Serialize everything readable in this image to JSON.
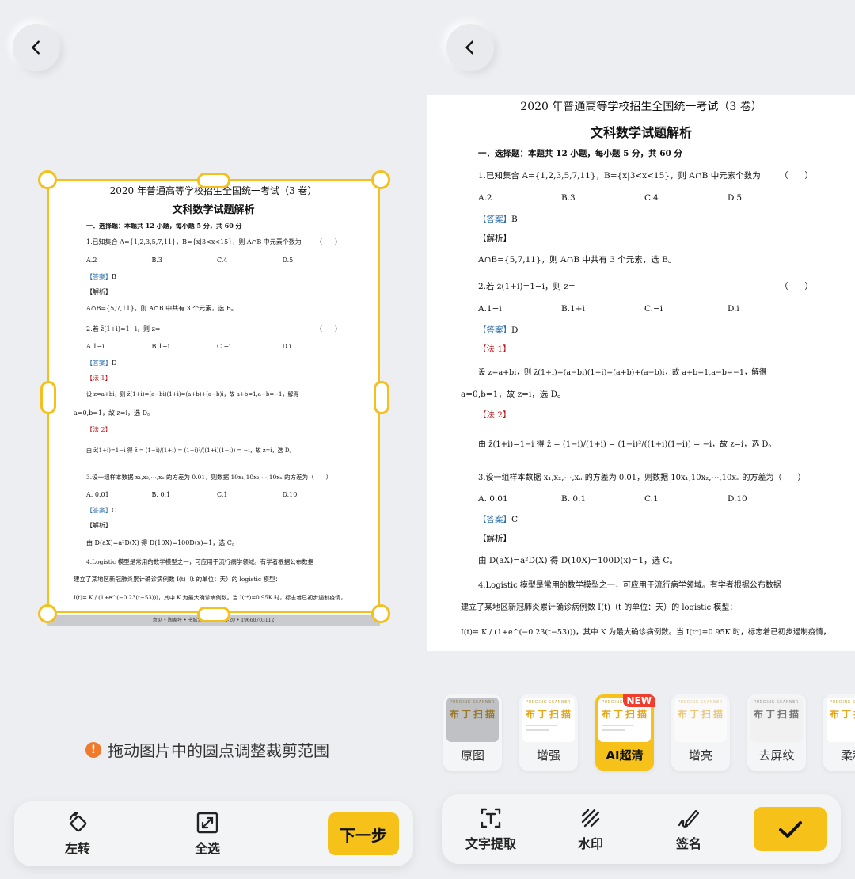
{
  "left": {
    "hint_text": "拖动图片中的圆点调整裁剪范围",
    "toolbar": {
      "rotate_label": "左转",
      "select_all_label": "全选",
      "next_label": "下一步"
    },
    "doc_footer": "意见 • 陶家坪 • 书城大桥东街 23A-20 • 19660703112"
  },
  "right": {
    "filters": [
      {
        "label": "原图"
      },
      {
        "label": "增强"
      },
      {
        "label": "AI超清",
        "badge": "NEW",
        "active": true
      },
      {
        "label": "增亮"
      },
      {
        "label": "去屏纹"
      },
      {
        "label": "柔和"
      }
    ],
    "toolbar": {
      "extract_label": "文字提取",
      "watermark_label": "水印",
      "sign_label": "签名"
    },
    "thumb_brand_en": "PUDDING SCANNER",
    "thumb_brand_cn": "布丁扫描"
  },
  "doc": {
    "title1": "2020 年普通高等学校招生全国统一考试（3 卷）",
    "title2": "文科数学试题解析",
    "section": "一．选择题：本题共 12 小题，每小题 5 分，共 60 分",
    "q1": "1.已知集合 A={1,2,3,5,7,11}，B={x|3<x<15}，则 A∩B 中元素个数为",
    "q1_paren": "（　　）",
    "q1_opts": [
      "A.2",
      "B.3",
      "C.4",
      "D.5"
    ],
    "ans_tag": "【答案】",
    "q1_ans": "B",
    "jiexi": "【解析】",
    "q1_sol": "A∩B={5,7,11}，则 A∩B 中共有 3 个元素，选 B。",
    "q2": "2.若 z̄(1+i)=1−i，则 z=",
    "q2_paren": "（　　）",
    "q2_opts": [
      "A.1−i",
      "B.1+i",
      "C.−i",
      "D.i"
    ],
    "q2_ans": "D",
    "fa1": "【法 1】",
    "q2_sol1a": "设 z=a+bi，则 z̄(1+i)=(a−bi)(1+i)=(a+b)+(a−b)i，故 a+b=1,a−b=−1，解得",
    "q2_sol1b": "a=0,b=1，故 z=i，选 D。",
    "fa2": "【法 2】",
    "q2_sol2": "由 z̄(1+i)=1−i 得 z̄ = (1−i)/(1+i) = (1−i)²/((1+i)(1−i)) = −i，故 z=i，选 D。",
    "q3": "3.设一组样本数据 x₁,x₂,⋯,xₙ 的方差为 0.01，则数据 10x₁,10x₂,⋯,10xₙ 的方差为（　　）",
    "q3_opts": [
      "A. 0.01",
      "B. 0.1",
      "C.1",
      "D.10"
    ],
    "q3_ans": "C",
    "q3_sol": "由 D(aX)=a²D(X) 得 D(10X)=100D(x)=1，选 C。",
    "q4a": "4.Logistic 模型是常用的数学模型之一，可应用于流行病学领域。有学者根据公布数据",
    "q4b": "建立了某地区新冠肺炎累计确诊病例数 I(t)（t 的单位：天）的 logistic 模型：",
    "q4c": "I(t)= K / (1+e^(−0.23(t−53)))，其中 K 为最大确诊病例数。当 I(t*)=0.95K 时，标志着已初步遏制疫情，"
  }
}
